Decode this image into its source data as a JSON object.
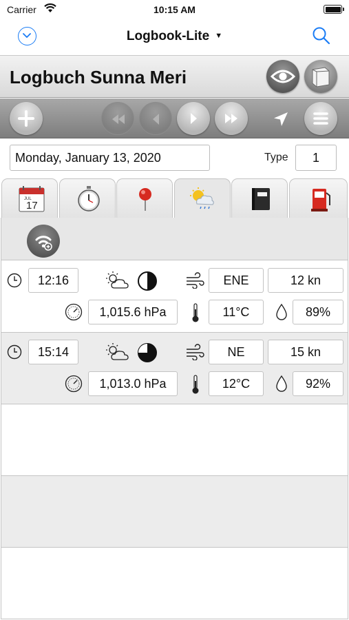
{
  "status_bar": {
    "carrier": "Carrier",
    "time": "10:15 AM"
  },
  "nav": {
    "title": "Logbook-Lite",
    "caret": "▼"
  },
  "logbook": {
    "title": "Logbuch Sunna Meri"
  },
  "date_row": {
    "date": "Monday, January 13, 2020",
    "type_label": "Type",
    "type_value": "1"
  },
  "tabs": [
    "calendar-tab",
    "stopwatch-tab",
    "location-tab",
    "weather-tab",
    "notebook-tab",
    "fuel-tab"
  ],
  "active_tab": "weather-tab",
  "tab_calendar": {
    "month": "JUL",
    "day": "17"
  },
  "entries": [
    {
      "time": "12:16",
      "wind_dir": "ENE",
      "wind_speed": "12 kn",
      "pressure": "1,015.6 hPa",
      "temperature": "11°C",
      "humidity": "89%",
      "moon": "half"
    },
    {
      "time": "15:14",
      "wind_dir": "NE",
      "wind_speed": "15 kn",
      "pressure": "1,013.0 hPa",
      "temperature": "12°C",
      "humidity": "92%",
      "moon": "three-quarter"
    }
  ],
  "colors": {
    "accent": "#1a7cf5",
    "toolbar": "#8f8f8f",
    "tab_bg": "#e7e7e7"
  }
}
